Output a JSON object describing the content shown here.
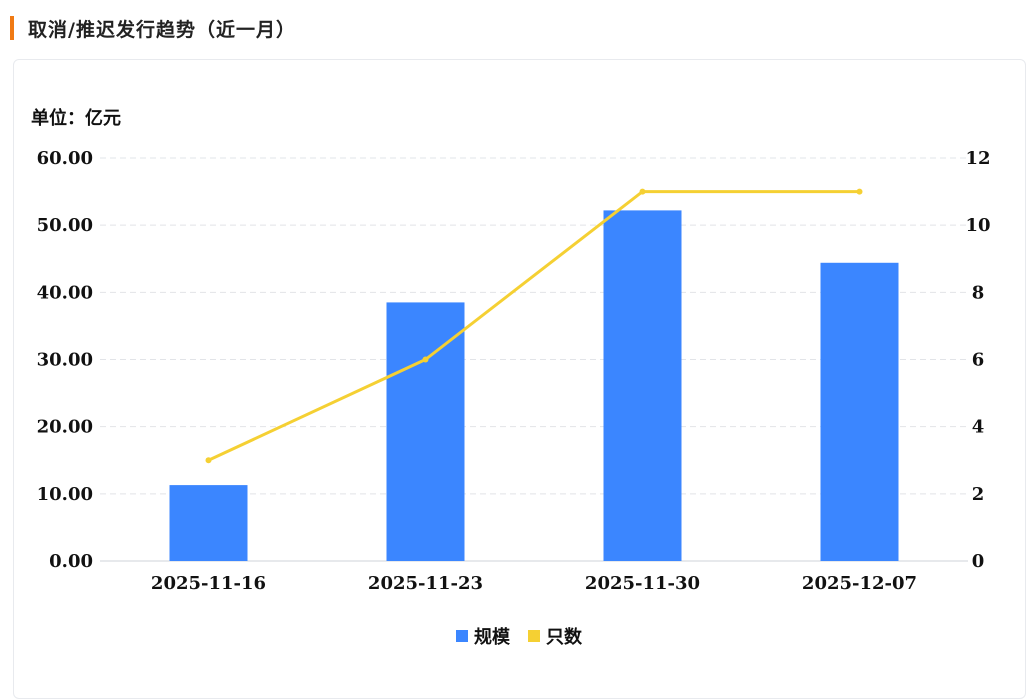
{
  "header": {
    "title": "取消/推迟发行趋势（近一月）"
  },
  "chart_data": {
    "type": "bar",
    "unit_label": "单位：亿元",
    "categories": [
      "2025-11-16",
      "2025-11-23",
      "2025-11-30",
      "2025-12-07"
    ],
    "series": [
      {
        "name": "规模",
        "type": "bar",
        "axis": "left",
        "color": "#3b86ff",
        "values": [
          11.3,
          38.5,
          52.2,
          44.4
        ]
      },
      {
        "name": "只数",
        "type": "line",
        "axis": "right",
        "color": "#f5d033",
        "values": [
          3,
          6,
          11,
          11
        ]
      }
    ],
    "left_axis": {
      "min": 0,
      "max": 60,
      "ticks": [
        "0.00",
        "10.00",
        "20.00",
        "30.00",
        "40.00",
        "50.00",
        "60.00"
      ]
    },
    "right_axis": {
      "min": 0,
      "max": 12,
      "ticks": [
        "0",
        "2",
        "4",
        "6",
        "8",
        "10",
        "12"
      ]
    },
    "grid": true,
    "legend_position": "bottom-center"
  }
}
